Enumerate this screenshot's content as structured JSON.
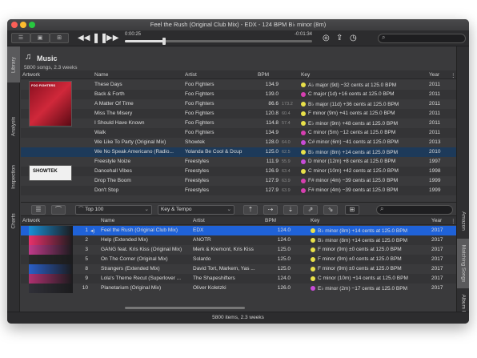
{
  "window": {
    "title": "Feel the Rush (Original Club Mix) - EDX - 124 BPM B♭ minor (8m)"
  },
  "player": {
    "elapsed": "0:00:25",
    "remaining": "-0:01:34",
    "progress": 0.21
  },
  "library": {
    "title": "Music",
    "subtitle": "5800 songs, 2.3 weeks"
  },
  "left_tabs": [
    "Library",
    "Analysis",
    "Inspection",
    "Charts"
  ],
  "right_tabs": [
    "Amazon",
    "Matching Songs",
    "Album Info"
  ],
  "top_table": {
    "headers": {
      "artwork": "Artwork",
      "name": "Name",
      "artist": "Artist",
      "bpm": "BPM",
      "key": "Key",
      "year": "Year"
    },
    "art_label_1": "FOO FIGHTERS",
    "art_label_2": "SHOWTEK",
    "rows": [
      {
        "name": "These Days",
        "artist": "Foo Fighters",
        "bpm": "134.9",
        "faint": "",
        "key": "A♭ major (9d) −32 cents at 125.0 BPM",
        "color": "#e8e04a",
        "year": "2011"
      },
      {
        "name": "Back & Forth",
        "artist": "Foo Fighters",
        "bpm": "139.0",
        "faint": "",
        "key": "C major (1d) +16 cents at 125.0 BPM",
        "color": "#d63fb0",
        "year": "2011"
      },
      {
        "name": "A Matter Of Time",
        "artist": "Foo Fighters",
        "bpm": "86.6",
        "faint": "173.2",
        "key": "B♭ major (11d) +36 cents at 125.0 BPM",
        "color": "#e8e04a",
        "year": "2011"
      },
      {
        "name": "Miss The Misery",
        "artist": "Foo Fighters",
        "bpm": "120.8",
        "faint": "60.4",
        "key": "F minor (9m) +41 cents at 125.0 BPM",
        "color": "#e8e04a",
        "year": "2011"
      },
      {
        "name": "I Should Have Known",
        "artist": "Foo Fighters",
        "bpm": "114.8",
        "faint": "57.4",
        "key": "E♭ minor (9m) +48 cents at 125.0 BPM",
        "color": "#e8e04a",
        "year": "2011"
      },
      {
        "name": "Walk",
        "artist": "Foo Fighters",
        "bpm": "134.9",
        "faint": "",
        "key": "C minor (5m) −12 cents at 125.0 BPM",
        "color": "#d63fb0",
        "year": "2011"
      },
      {
        "name": "We Like To Party (Original Mix)",
        "artist": "Showtek",
        "bpm": "128.0",
        "faint": "64.0",
        "key": "C# minor (6m) −41 cents at 125.0 BPM",
        "color": "#c84cd8",
        "year": "2013"
      },
      {
        "name": "We No Speak Americano (Radio...",
        "artist": "Yolanda Be Cool & Dcup",
        "bpm": "125.0",
        "faint": "62.5",
        "key": "B♭ minor (8m) +14 cents at 125.0 BPM",
        "color": "#e8e04a",
        "year": "2010"
      },
      {
        "name": "Freestyle Noize",
        "artist": "Freestyles",
        "bpm": "111.9",
        "faint": "55.9",
        "key": "D minor (12m) +8 cents at 125.0 BPM",
        "color": "#c84cd8",
        "year": "1997"
      },
      {
        "name": "Dancehall Vibes",
        "artist": "Freestyles",
        "bpm": "126.9",
        "faint": "63.4",
        "key": "C minor (10m) +42 cents at 125.0 BPM",
        "color": "#e8e04a",
        "year": "1998"
      },
      {
        "name": "Drop The Boom",
        "artist": "Freestyles",
        "bpm": "127.9",
        "faint": "63.9",
        "key": "F# minor (4m) −39 cents at 125.0 BPM",
        "color": "#d63fb0",
        "year": "1999"
      },
      {
        "name": "Don't Stop",
        "artist": "Freestyles",
        "bpm": "127.9",
        "faint": "63.9",
        "key": "F# minor (4m) −39 cents at 125.0 BPM",
        "color": "#d63fb0",
        "year": "1999"
      }
    ]
  },
  "filters": {
    "playlist": "Top 100",
    "sort": "Key & Tempo"
  },
  "bottom_table": {
    "headers": {
      "artwork": "Artwork",
      "name": "Name",
      "artist": "Artist",
      "bpm": "BPM",
      "key": "Key",
      "year": "Year"
    },
    "rows": [
      {
        "num": "1",
        "name": "Feel the Rush (Original Club Mix)",
        "artist": "EDX",
        "bpm": "124.0",
        "key": "B♭ minor (8m) +14 cents at 125.0 BPM",
        "color": "#e8e04a",
        "year": "2017",
        "thumb": "#1a8fd6"
      },
      {
        "num": "2",
        "name": "Help (Extended Mix)",
        "artist": "ANOTR",
        "bpm": "124.0",
        "key": "B♭ minor (8m) +14 cents at 125.0 BPM",
        "color": "#e8e04a",
        "year": "2017",
        "thumb": "#e8306a"
      },
      {
        "num": "3",
        "name": "GANG feat. Kris Kiss (Original Mix)",
        "artist": "Merk & Kremont, Kris Kiss",
        "bpm": "125.0",
        "key": "F minor (9m) ±0 cents at 125.0 BPM",
        "color": "#e8e04a",
        "year": "2017",
        "thumb": "#c03a8a"
      },
      {
        "num": "5",
        "name": "On The Corner (Original Mix)",
        "artist": "Solardo",
        "bpm": "125.0",
        "key": "F minor (9m) ±0 cents at 125.0 BPM",
        "color": "#e8e04a",
        "year": "2017",
        "thumb": "#2a2a2a"
      },
      {
        "num": "8",
        "name": "Strangers (Extended Mix)",
        "artist": "David Tort, Markem, Yas ...",
        "bpm": "125.0",
        "key": "F minor (9m) ±0 cents at 125.0 BPM",
        "color": "#e8e04a",
        "year": "2017",
        "thumb": "#2a5fc8"
      },
      {
        "num": "9",
        "name": "Lola's Theme Recut (Superlover ...",
        "artist": "The Shapeshifters",
        "bpm": "124.0",
        "key": "C minor (10m) +14 cents at 125.0 BPM",
        "color": "#e8e04a",
        "year": "2017",
        "thumb": "#b03070"
      },
      {
        "num": "10",
        "name": "Planetarium (Original Mix)",
        "artist": "Oliver Koletzki",
        "bpm": "126.0",
        "key": "E♭ minor (2m) −17 cents at 125.0 BPM",
        "color": "#c84cd8",
        "year": "2017",
        "thumb": "#303038"
      }
    ]
  },
  "status": {
    "text": "5800 items, 2.3 weeks"
  }
}
